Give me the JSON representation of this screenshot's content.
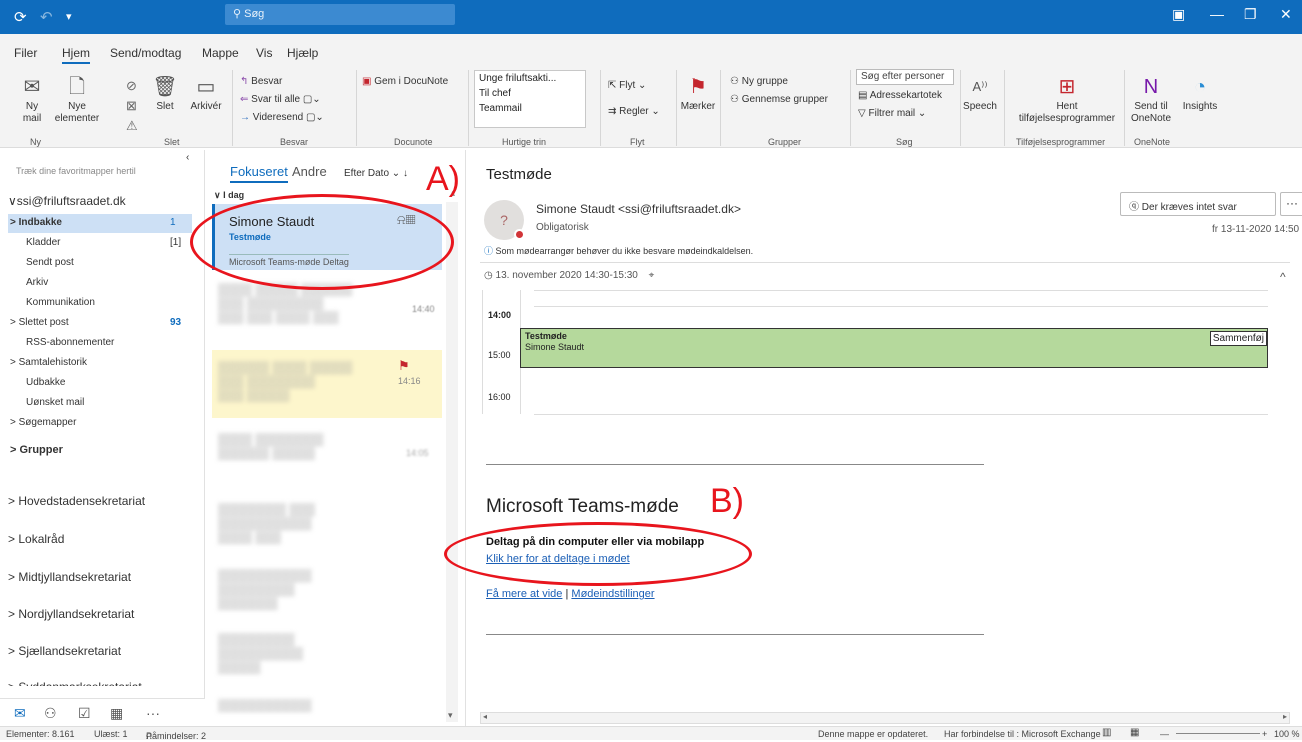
{
  "titlebar": {
    "search": "Søg"
  },
  "menu": [
    "Filer",
    "Hjem",
    "Send/modtag",
    "Mappe",
    "Vis",
    "Hjælp"
  ],
  "ribbon": {
    "new_mail": "Ny\nmail",
    "new_items": "Nye\nelementer",
    "delete": "Slet",
    "archive": "Arkivér",
    "reply": "Besvar",
    "reply_all": "Svar til alle",
    "forward": "Videresend",
    "save_docunote": "Gem i DocuNote",
    "quick": [
      "Unge friluftsakti...",
      "Til chef",
      "Teammail"
    ],
    "move": "Flyt",
    "rules": "Regler",
    "tags": "Mærker",
    "new_group": "Ny gruppe",
    "browse_groups": "Gennemse grupper",
    "search_people": "Søg efter personer",
    "address_book": "Adressekartotek",
    "filter_mail": "Filtrer mail",
    "speech": "Speech",
    "get_addins": "Hent\ntilføjelsesprogrammer",
    "send_onenote": "Send til\nOneNote",
    "insights": "Insights",
    "groups": [
      "Ny",
      "Slet",
      "Besvar",
      "Docunote",
      "Hurtige trin",
      "Flyt",
      "",
      "Grupper",
      "Søg",
      "Tilføjelsesprogrammer",
      "OneNote"
    ]
  },
  "folders": {
    "fav_hint": "Træk dine favoritmapper hertil",
    "account": "ssi@friluftsraadet.dk",
    "items": [
      {
        "label": "> Indbakke",
        "count": "1"
      },
      {
        "label": "Kladder",
        "count": "[1]"
      },
      {
        "label": "Sendt post",
        "count": ""
      },
      {
        "label": "Arkiv",
        "count": ""
      },
      {
        "label": "Kommunikation",
        "count": ""
      },
      {
        "label": "> Slettet post",
        "count": "93"
      },
      {
        "label": "RSS-abonnementer",
        "count": ""
      },
      {
        "label": "> Samtalehistorik",
        "count": ""
      },
      {
        "label": "Udbakke",
        "count": ""
      },
      {
        "label": "Uønsket mail",
        "count": ""
      },
      {
        "label": "> Søgemapper",
        "count": ""
      },
      {
        "label": "> Grupper",
        "count": ""
      }
    ],
    "regions": [
      "> Hovedstadensekretariat",
      "> Lokalråd",
      "> Midtjyllandsekretariat",
      "> Nordjyllandsekretariat",
      "> Sjællandsekretariat",
      "> Syddanmarksekretariat"
    ]
  },
  "list": {
    "tab_focused": "Fokuseret",
    "tab_other": "Andre",
    "sort": "Efter Dato",
    "today": "I dag",
    "selected": {
      "sender": "Simone Staudt",
      "subject": "Testmøde",
      "preview": "Microsoft Teams-møde  Deltag"
    },
    "times": [
      "14:40",
      "14:16",
      "14:05"
    ]
  },
  "reading": {
    "subject": "Testmøde",
    "from": "Simone Staudt <ssi@friluftsraadet.dk>",
    "required": "Obligatorisk",
    "no_reply": "Der kræves intet svar",
    "date": "fr 13-11-2020 14:50",
    "info": "Som mødearrangør behøver du ikke besvare mødeindkaldelsen.",
    "when": "13. november 2020 14:30-15:30",
    "hours": [
      "14:00",
      "15:00",
      "16:00"
    ],
    "event_title": "Testmøde",
    "event_org": "Simone Staudt",
    "merge": "Sammenføj",
    "teams_title": "Microsoft Teams-møde",
    "join_bold": "Deltag på din computer eller via mobilapp",
    "join_link": "Klik her for at deltage i mødet",
    "learn_more": "Få mere at vide",
    "separator": "|",
    "settings": "Mødeindstillinger"
  },
  "annotations": {
    "a": "A)",
    "b": "B)"
  },
  "status": {
    "items": "Elementer: 8.161",
    "unread": "Ulæst: 1",
    "reminders": "Påmindelser: 2",
    "updated": "Denne mappe er opdateret.",
    "connected": "Har forbindelse til : Microsoft Exchange",
    "zoom": "100 %"
  },
  "colors": {
    "accent": "#0f6cbd",
    "annotation": "#e8151d",
    "event": "#b5d99c"
  }
}
